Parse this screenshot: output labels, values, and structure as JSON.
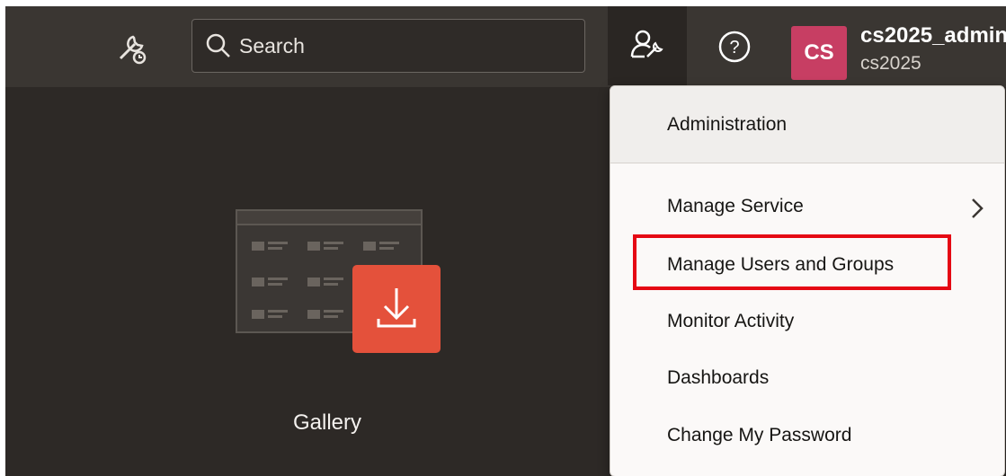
{
  "topbar": {
    "search_placeholder": "Search",
    "user": {
      "initials": "CS",
      "name": "cs2025_admin",
      "tenant": "cs2025"
    }
  },
  "gallery": {
    "label": "Gallery"
  },
  "dropdown": {
    "header": "Administration",
    "items": [
      {
        "label": "Manage Service",
        "has_submenu": true
      },
      {
        "label": "Manage Users and Groups",
        "highlighted": true
      },
      {
        "label": "Monitor Activity"
      },
      {
        "label": "Dashboards"
      },
      {
        "label": "Change My Password"
      }
    ]
  },
  "colors": {
    "background": "#2d2926",
    "topbar": "#3a3632",
    "avatar": "#c73e63",
    "download_badge": "#e4513b",
    "highlight_box": "#e50914"
  },
  "icons": [
    "tools-icon",
    "search-icon",
    "admin-user-wrench-icon",
    "help-icon",
    "chevron-right-icon",
    "download-icon",
    "gallery-grid-icon"
  ]
}
